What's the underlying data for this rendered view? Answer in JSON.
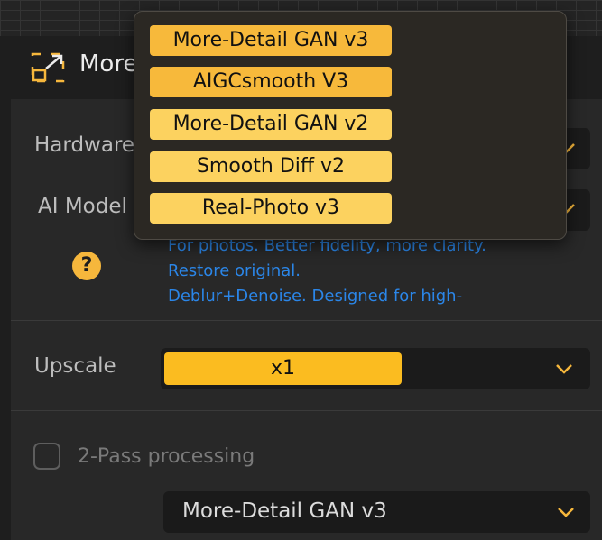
{
  "header": {
    "title": "More"
  },
  "rows": {
    "hardware_label": "Hardware",
    "ai_model_label": "AI Model",
    "upscale_label": "Upscale",
    "upscale_value": "x1"
  },
  "descriptions": [
    "For photos. Better fidelity, more clarity.",
    "Restore original.",
    " Deblur+Denoise. Designed for high-"
  ],
  "two_pass": {
    "label": "2-Pass processing",
    "checked": false
  },
  "second_model": {
    "value": "More-Detail GAN v3"
  },
  "dropdown": {
    "options": [
      "More-Detail GAN v3",
      "AIGCsmooth  V3",
      "More-Detail GAN v2",
      "Smooth Diff v2",
      "Real-Photo v3"
    ]
  },
  "colors": {
    "accent": "#fbbc20",
    "option_bg": "#fcd25f",
    "link_blue": "#2b86e8",
    "panel": "#282828"
  }
}
